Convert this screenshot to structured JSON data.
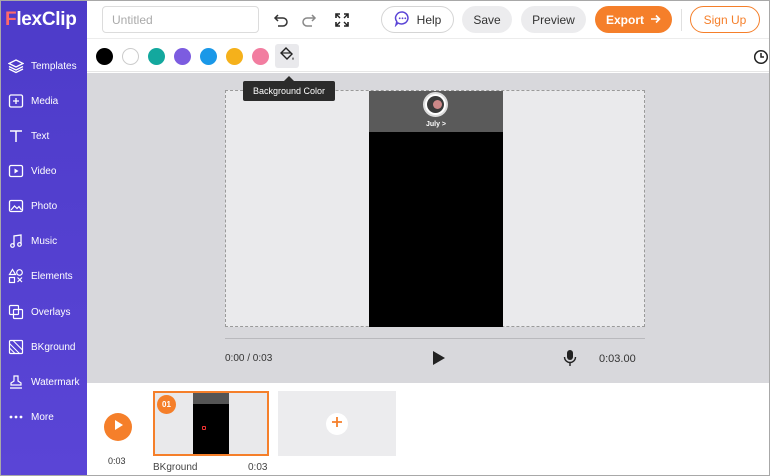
{
  "app": {
    "logo_text_f": "F",
    "logo_text_rest": "lexClip"
  },
  "sidebar": {
    "items": [
      {
        "label": "Templates",
        "icon": "layers-icon"
      },
      {
        "label": "Media",
        "icon": "media-icon"
      },
      {
        "label": "Text",
        "icon": "text-icon"
      },
      {
        "label": "Video",
        "icon": "video-icon"
      },
      {
        "label": "Photo",
        "icon": "photo-icon"
      },
      {
        "label": "Music",
        "icon": "music-icon"
      },
      {
        "label": "Elements",
        "icon": "elements-icon"
      },
      {
        "label": "Overlays",
        "icon": "overlays-icon"
      },
      {
        "label": "BKground",
        "icon": "background-icon"
      },
      {
        "label": "Watermark",
        "icon": "watermark-icon"
      },
      {
        "label": "More",
        "icon": "more-icon"
      }
    ]
  },
  "topbar": {
    "title_placeholder": "Untitled",
    "help_label": "Help",
    "save_label": "Save",
    "preview_label": "Preview",
    "export_label": "Export",
    "signup_label": "Sign Up"
  },
  "colorbar": {
    "swatches": [
      "#000000",
      "#ffffff",
      "#13a89e",
      "#7c5ce0",
      "#1a98e8",
      "#f5b11b",
      "#f27da0"
    ],
    "tooltip": "Background Color"
  },
  "canvas": {
    "phone_text": "July >"
  },
  "player": {
    "current_time": "0:00 / 0:03",
    "duration": "0:03.00"
  },
  "timeline": {
    "total_time": "0:03",
    "clips": [
      {
        "number": "01",
        "name": "BKground",
        "duration": "0:03"
      }
    ]
  }
}
